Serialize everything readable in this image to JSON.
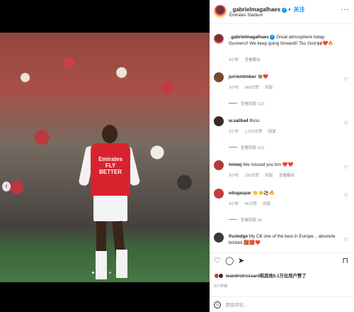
{
  "post": {
    "username": "_gabrielmagalhaes",
    "verified_glyph": "✓",
    "follow_label": "关注",
    "location": "Emirates Stadium",
    "more_glyph": "···",
    "sponsor_text": "Emirates FLY BETTER"
  },
  "caption": {
    "username": "_gabrielmagalhaes",
    "text": "Great atmosphere today Gunners!! We keep going forward!! Tks God 🙌🏾❤️🔥",
    "time": "3小时",
    "translate": "查看翻译"
  },
  "comments": [
    {
      "username": "jurrientimber",
      "text": "👏🏽❤️",
      "time": "3小时",
      "likes": "969次赞",
      "reply": "回复",
      "replies": "查看回复 (12)",
      "avatar_color": "#7a4a2e"
    },
    {
      "username": "w.saliba4",
      "text": "Boss",
      "time": "3小时",
      "likes": "1,329次赞",
      "reply": "回复",
      "replies": "查看回复 (12)",
      "avatar_color": "#3b2a22"
    },
    {
      "username": "tmmej",
      "text": "We missed you bro ❤️❤️",
      "time": "3小时",
      "likes": "235次赞",
      "reply": "回复",
      "translate": "查看翻译",
      "avatar_color": "#b23a3a"
    },
    {
      "username": "edugaspar",
      "text": "👏👏⚽🔥",
      "time": "3小时",
      "likes": "46次赞",
      "reply": "回复",
      "replies": "查看回复 (4)",
      "avatar_color": "#c73b3b"
    },
    {
      "username": "fivzledge",
      "text": "My CB one of the best in Europe .. absolute brickkk 🧱🧱❤️",
      "time": "",
      "avatar_color": "#3a3a3a"
    }
  ],
  "actions": {
    "like_icon": "♡",
    "comment_icon": "◯",
    "share_icon": "➤",
    "save_icon": "⊓"
  },
  "likes_text": "leandrotrossard和其他5.1万位用户赞了",
  "post_time": "3小时前",
  "add_comment": {
    "emoji_icon": "☺",
    "placeholder": "添加评论..."
  },
  "media": {
    "prev_glyph": "‹",
    "dots": 5,
    "active_dot": 0
  },
  "colors": {
    "accent": "#0095f6",
    "arsenal_red": "#d8232f",
    "text": "#262626",
    "muted": "#8e8e8e"
  }
}
